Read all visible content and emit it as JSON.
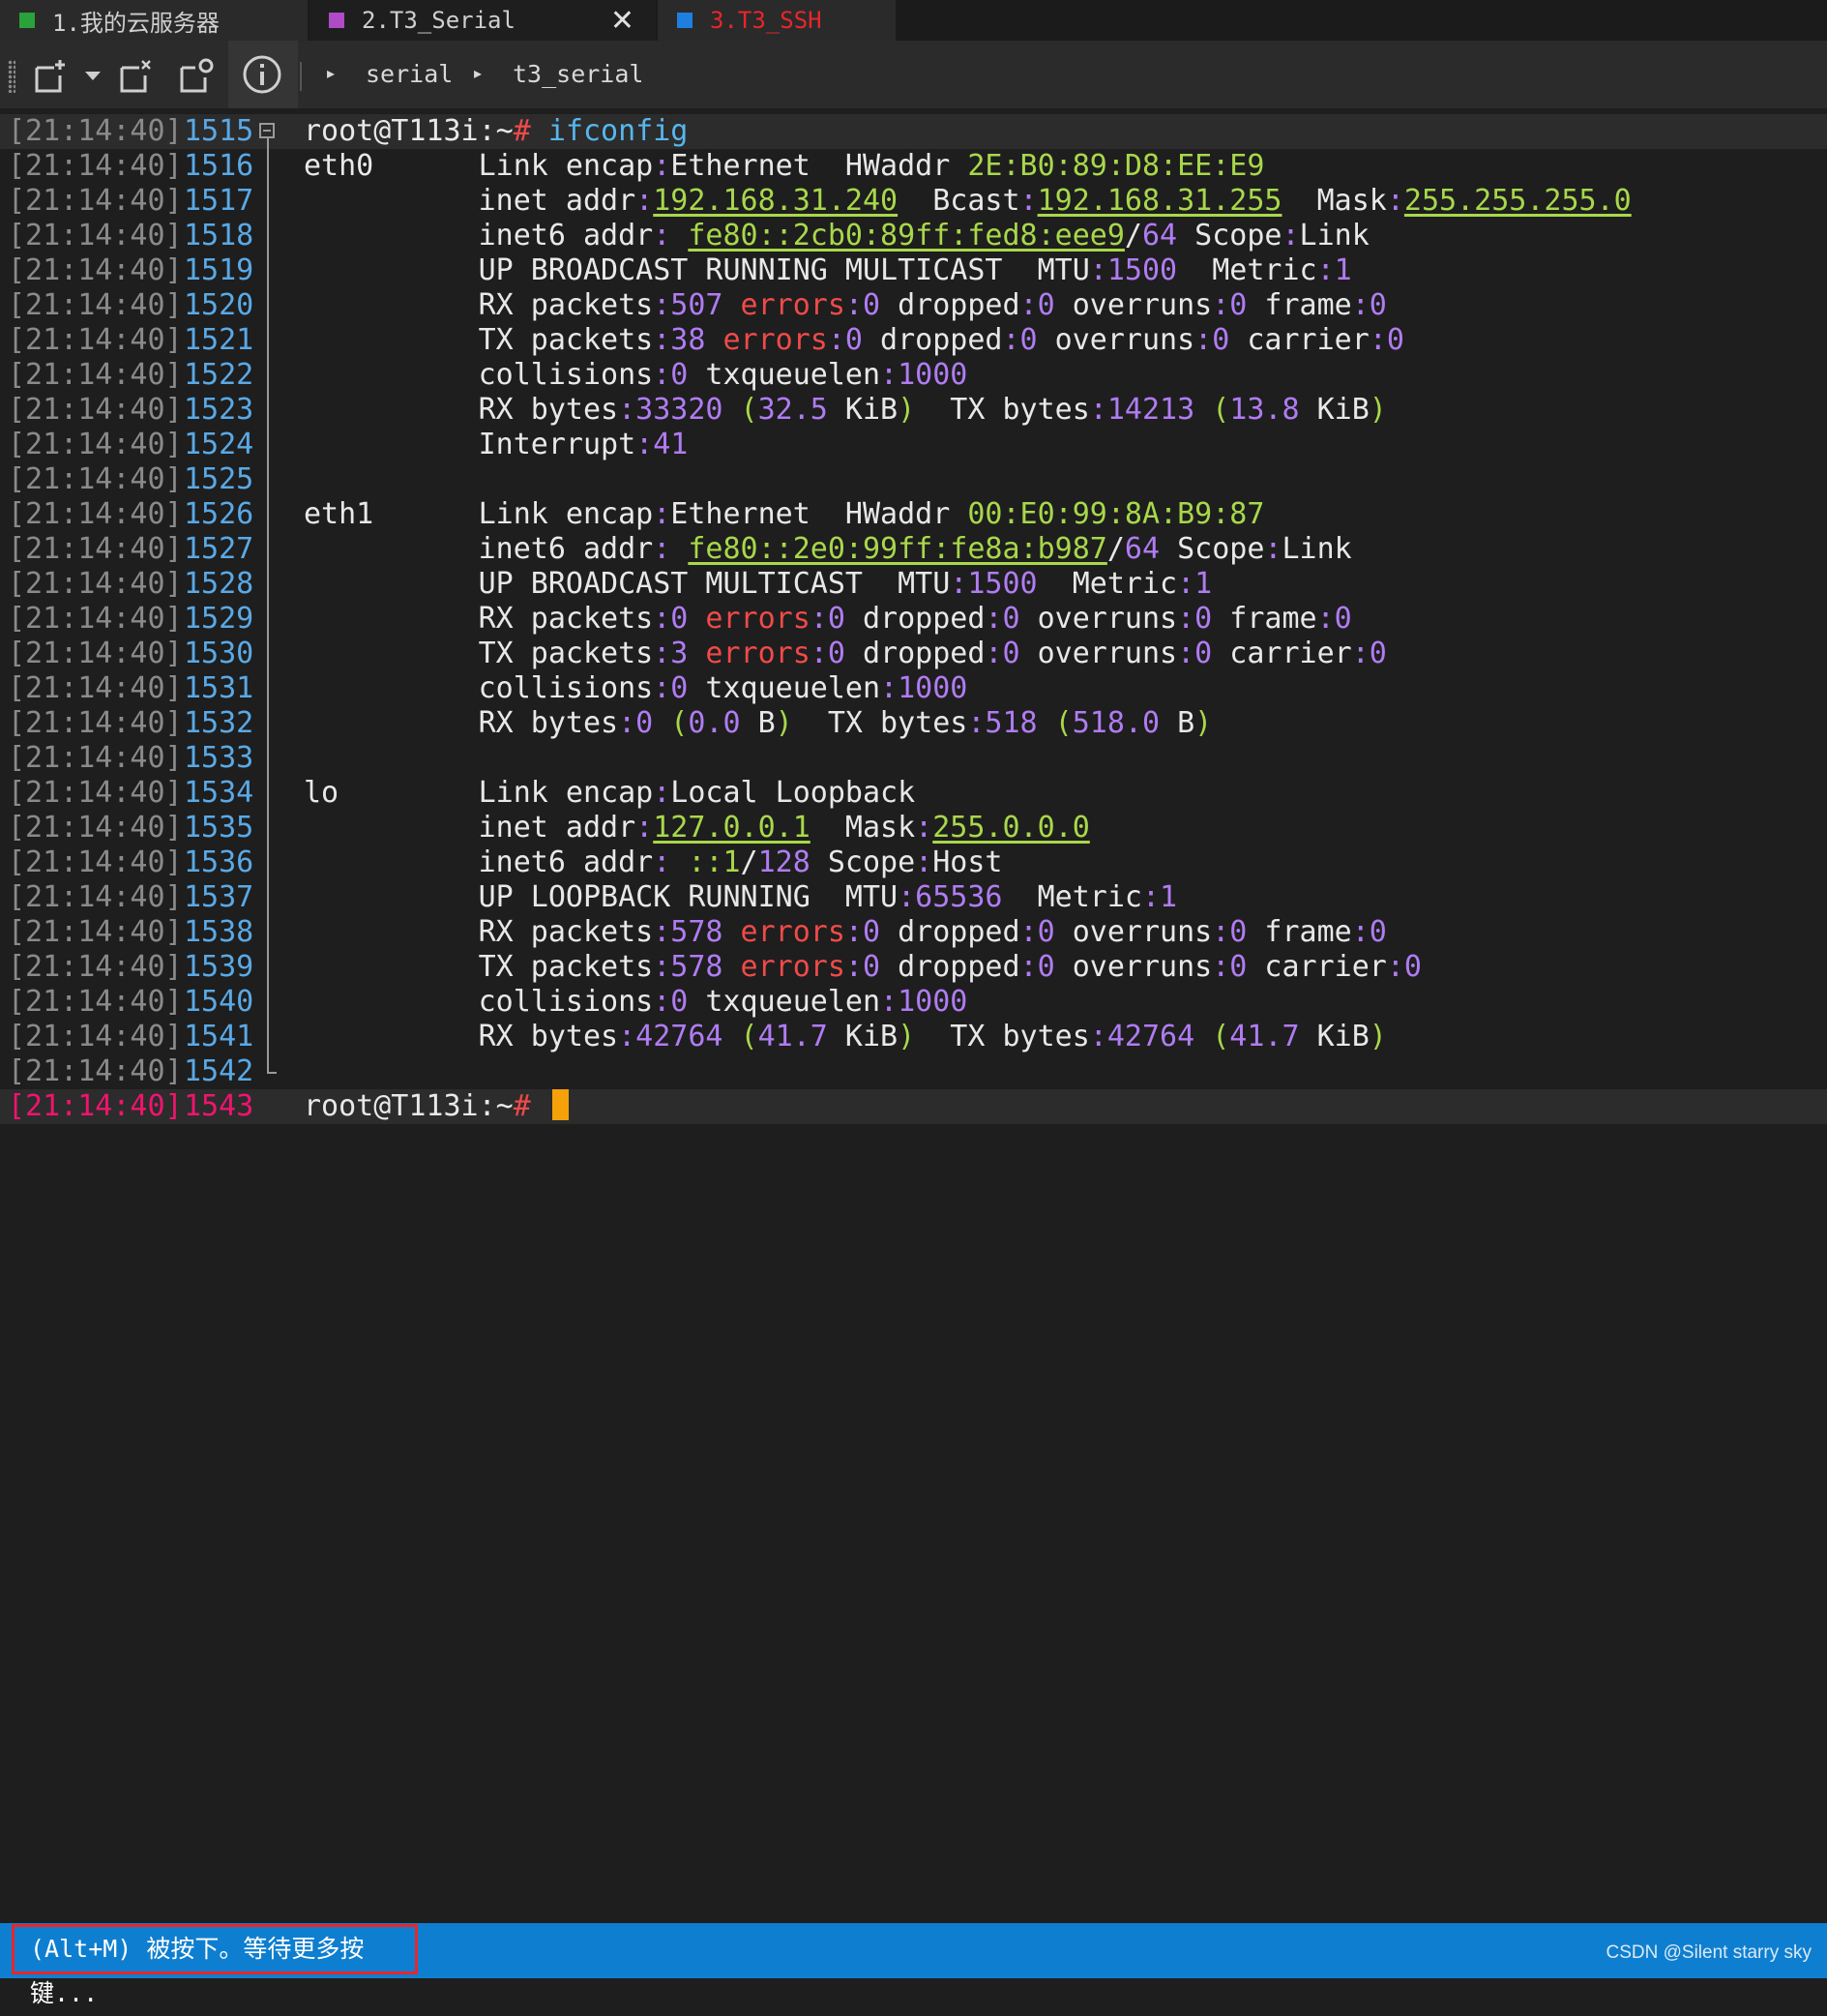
{
  "tabs": [
    {
      "label": "1.我的云服务器",
      "color": "#2aa13a"
    },
    {
      "label": "2.T3_Serial",
      "color": "#b04bc8"
    },
    {
      "label": "3.T3_SSH",
      "color": "#1e7fe0"
    }
  ],
  "toolbar": {
    "icons": [
      "grip-icon",
      "new-session-icon",
      "dropdown-chevron-icon",
      "close-session-icon",
      "duplicate-session-icon",
      "info-icon"
    ],
    "breadcrumb": [
      "serial",
      "t3_serial"
    ]
  },
  "terminal": {
    "timestamp": "[21:14:40]",
    "lines": [
      {
        "n": "1515",
        "segs": [
          [
            "root@T113i:~",
            "w"
          ],
          [
            "# ",
            "r"
          ],
          [
            "ifconfig",
            "b"
          ]
        ]
      },
      {
        "n": "1516",
        "segs": [
          [
            "eth0      Link encap",
            "w"
          ],
          [
            ":",
            "p"
          ],
          [
            "Ethernet  HWaddr ",
            "w"
          ],
          [
            "2E:B0:89:D8:EE:E9",
            "g"
          ]
        ]
      },
      {
        "n": "1517",
        "segs": [
          [
            "          inet addr",
            "w"
          ],
          [
            ":",
            "p"
          ],
          [
            "192.168.31.240",
            "gu"
          ],
          [
            "  Bcast",
            "w"
          ],
          [
            ":",
            "p"
          ],
          [
            "192.168.31.255",
            "gu"
          ],
          [
            "  Mask",
            "w"
          ],
          [
            ":",
            "p"
          ],
          [
            "255.255.255.0",
            "gu"
          ]
        ]
      },
      {
        "n": "1518",
        "segs": [
          [
            "          inet6 addr",
            "w"
          ],
          [
            ": ",
            "p"
          ],
          [
            "fe80::2cb0:89ff:fed8:eee9",
            "gu"
          ],
          [
            "/",
            "w"
          ],
          [
            "64",
            "p"
          ],
          [
            " Scope",
            "w"
          ],
          [
            ":",
            "p"
          ],
          [
            "Link",
            "w"
          ]
        ]
      },
      {
        "n": "1519",
        "segs": [
          [
            "          UP BROADCAST RUNNING MULTICAST  MTU",
            "w"
          ],
          [
            ":",
            "p"
          ],
          [
            "1500",
            "p"
          ],
          [
            "  Metric",
            "w"
          ],
          [
            ":",
            "p"
          ],
          [
            "1",
            "p"
          ]
        ]
      },
      {
        "n": "1520",
        "segs": [
          [
            "          RX packets",
            "w"
          ],
          [
            ":",
            "p"
          ],
          [
            "507",
            "p"
          ],
          [
            " errors",
            "r"
          ],
          [
            ":",
            "p"
          ],
          [
            "0",
            "p"
          ],
          [
            " dropped",
            "w"
          ],
          [
            ":",
            "p"
          ],
          [
            "0",
            "p"
          ],
          [
            " overruns",
            "w"
          ],
          [
            ":",
            "p"
          ],
          [
            "0",
            "p"
          ],
          [
            " frame",
            "w"
          ],
          [
            ":",
            "p"
          ],
          [
            "0",
            "p"
          ]
        ]
      },
      {
        "n": "1521",
        "segs": [
          [
            "          TX packets",
            "w"
          ],
          [
            ":",
            "p"
          ],
          [
            "38",
            "p"
          ],
          [
            " errors",
            "r"
          ],
          [
            ":",
            "p"
          ],
          [
            "0",
            "p"
          ],
          [
            " dropped",
            "w"
          ],
          [
            ":",
            "p"
          ],
          [
            "0",
            "p"
          ],
          [
            " overruns",
            "w"
          ],
          [
            ":",
            "p"
          ],
          [
            "0",
            "p"
          ],
          [
            " carrier",
            "w"
          ],
          [
            ":",
            "p"
          ],
          [
            "0",
            "p"
          ]
        ]
      },
      {
        "n": "1522",
        "segs": [
          [
            "          collisions",
            "w"
          ],
          [
            ":",
            "p"
          ],
          [
            "0",
            "p"
          ],
          [
            " txqueuelen",
            "w"
          ],
          [
            ":",
            "p"
          ],
          [
            "1000",
            "p"
          ]
        ]
      },
      {
        "n": "1523",
        "segs": [
          [
            "          RX bytes",
            "w"
          ],
          [
            ":",
            "p"
          ],
          [
            "33320",
            "p"
          ],
          [
            " (",
            "g"
          ],
          [
            "32.5",
            "p"
          ],
          [
            " KiB",
            "w"
          ],
          [
            ")",
            "g"
          ],
          [
            "  TX bytes",
            "w"
          ],
          [
            ":",
            "p"
          ],
          [
            "14213",
            "p"
          ],
          [
            " (",
            "g"
          ],
          [
            "13.8",
            "p"
          ],
          [
            " KiB",
            "w"
          ],
          [
            ")",
            "g"
          ]
        ]
      },
      {
        "n": "1524",
        "segs": [
          [
            "          Interrupt",
            "w"
          ],
          [
            ":",
            "p"
          ],
          [
            "41",
            "p"
          ]
        ]
      },
      {
        "n": "1525",
        "segs": []
      },
      {
        "n": "1526",
        "segs": [
          [
            "eth1      Link encap",
            "w"
          ],
          [
            ":",
            "p"
          ],
          [
            "Ethernet  HWaddr ",
            "w"
          ],
          [
            "00:E0:99:8A:B9:87",
            "g"
          ]
        ]
      },
      {
        "n": "1527",
        "segs": [
          [
            "          inet6 addr",
            "w"
          ],
          [
            ": ",
            "p"
          ],
          [
            "fe80::2e0:99ff:fe8a:b987",
            "gu"
          ],
          [
            "/",
            "w"
          ],
          [
            "64",
            "p"
          ],
          [
            " Scope",
            "w"
          ],
          [
            ":",
            "p"
          ],
          [
            "Link",
            "w"
          ]
        ]
      },
      {
        "n": "1528",
        "segs": [
          [
            "          UP BROADCAST MULTICAST  MTU",
            "w"
          ],
          [
            ":",
            "p"
          ],
          [
            "1500",
            "p"
          ],
          [
            "  Metric",
            "w"
          ],
          [
            ":",
            "p"
          ],
          [
            "1",
            "p"
          ]
        ]
      },
      {
        "n": "1529",
        "segs": [
          [
            "          RX packets",
            "w"
          ],
          [
            ":",
            "p"
          ],
          [
            "0",
            "p"
          ],
          [
            " errors",
            "r"
          ],
          [
            ":",
            "p"
          ],
          [
            "0",
            "p"
          ],
          [
            " dropped",
            "w"
          ],
          [
            ":",
            "p"
          ],
          [
            "0",
            "p"
          ],
          [
            " overruns",
            "w"
          ],
          [
            ":",
            "p"
          ],
          [
            "0",
            "p"
          ],
          [
            " frame",
            "w"
          ],
          [
            ":",
            "p"
          ],
          [
            "0",
            "p"
          ]
        ]
      },
      {
        "n": "1530",
        "segs": [
          [
            "          TX packets",
            "w"
          ],
          [
            ":",
            "p"
          ],
          [
            "3",
            "p"
          ],
          [
            " errors",
            "r"
          ],
          [
            ":",
            "p"
          ],
          [
            "0",
            "p"
          ],
          [
            " dropped",
            "w"
          ],
          [
            ":",
            "p"
          ],
          [
            "0",
            "p"
          ],
          [
            " overruns",
            "w"
          ],
          [
            ":",
            "p"
          ],
          [
            "0",
            "p"
          ],
          [
            " carrier",
            "w"
          ],
          [
            ":",
            "p"
          ],
          [
            "0",
            "p"
          ]
        ]
      },
      {
        "n": "1531",
        "segs": [
          [
            "          collisions",
            "w"
          ],
          [
            ":",
            "p"
          ],
          [
            "0",
            "p"
          ],
          [
            " txqueuelen",
            "w"
          ],
          [
            ":",
            "p"
          ],
          [
            "1000",
            "p"
          ]
        ]
      },
      {
        "n": "1532",
        "segs": [
          [
            "          RX bytes",
            "w"
          ],
          [
            ":",
            "p"
          ],
          [
            "0",
            "p"
          ],
          [
            " (",
            "g"
          ],
          [
            "0.0",
            "p"
          ],
          [
            " B",
            "w"
          ],
          [
            ")",
            "g"
          ],
          [
            "  TX bytes",
            "w"
          ],
          [
            ":",
            "p"
          ],
          [
            "518",
            "p"
          ],
          [
            " (",
            "g"
          ],
          [
            "518.0",
            "p"
          ],
          [
            " B",
            "w"
          ],
          [
            ")",
            "g"
          ]
        ]
      },
      {
        "n": "1533",
        "segs": []
      },
      {
        "n": "1534",
        "segs": [
          [
            "lo        Link encap",
            "w"
          ],
          [
            ":",
            "p"
          ],
          [
            "Local Loopback",
            "w"
          ]
        ]
      },
      {
        "n": "1535",
        "segs": [
          [
            "          inet addr",
            "w"
          ],
          [
            ":",
            "p"
          ],
          [
            "127.0.0.1",
            "gu"
          ],
          [
            "  Mask",
            "w"
          ],
          [
            ":",
            "p"
          ],
          [
            "255.0.0.0",
            "gu"
          ]
        ]
      },
      {
        "n": "1536",
        "segs": [
          [
            "          inet6 addr",
            "w"
          ],
          [
            ": ",
            "p"
          ],
          [
            "::1",
            "g"
          ],
          [
            "/",
            "w"
          ],
          [
            "128",
            "p"
          ],
          [
            " Scope",
            "w"
          ],
          [
            ":",
            "p"
          ],
          [
            "Host",
            "w"
          ]
        ]
      },
      {
        "n": "1537",
        "segs": [
          [
            "          UP LOOPBACK RUNNING  MTU",
            "w"
          ],
          [
            ":",
            "p"
          ],
          [
            "65536",
            "p"
          ],
          [
            "  Metric",
            "w"
          ],
          [
            ":",
            "p"
          ],
          [
            "1",
            "p"
          ]
        ]
      },
      {
        "n": "1538",
        "segs": [
          [
            "          RX packets",
            "w"
          ],
          [
            ":",
            "p"
          ],
          [
            "578",
            "p"
          ],
          [
            " errors",
            "r"
          ],
          [
            ":",
            "p"
          ],
          [
            "0",
            "p"
          ],
          [
            " dropped",
            "w"
          ],
          [
            ":",
            "p"
          ],
          [
            "0",
            "p"
          ],
          [
            " overruns",
            "w"
          ],
          [
            ":",
            "p"
          ],
          [
            "0",
            "p"
          ],
          [
            " frame",
            "w"
          ],
          [
            ":",
            "p"
          ],
          [
            "0",
            "p"
          ]
        ]
      },
      {
        "n": "1539",
        "segs": [
          [
            "          TX packets",
            "w"
          ],
          [
            ":",
            "p"
          ],
          [
            "578",
            "p"
          ],
          [
            " errors",
            "r"
          ],
          [
            ":",
            "p"
          ],
          [
            "0",
            "p"
          ],
          [
            " dropped",
            "w"
          ],
          [
            ":",
            "p"
          ],
          [
            "0",
            "p"
          ],
          [
            " overruns",
            "w"
          ],
          [
            ":",
            "p"
          ],
          [
            "0",
            "p"
          ],
          [
            " carrier",
            "w"
          ],
          [
            ":",
            "p"
          ],
          [
            "0",
            "p"
          ]
        ]
      },
      {
        "n": "1540",
        "segs": [
          [
            "          collisions",
            "w"
          ],
          [
            ":",
            "p"
          ],
          [
            "0",
            "p"
          ],
          [
            " txqueuelen",
            "w"
          ],
          [
            ":",
            "p"
          ],
          [
            "1000",
            "p"
          ]
        ]
      },
      {
        "n": "1541",
        "segs": [
          [
            "          RX bytes",
            "w"
          ],
          [
            ":",
            "p"
          ],
          [
            "42764",
            "p"
          ],
          [
            " (",
            "g"
          ],
          [
            "41.7",
            "p"
          ],
          [
            " KiB",
            "w"
          ],
          [
            ")",
            "g"
          ],
          [
            "  TX bytes",
            "w"
          ],
          [
            ":",
            "p"
          ],
          [
            "42764",
            "p"
          ],
          [
            " (",
            "g"
          ],
          [
            "41.7",
            "p"
          ],
          [
            " KiB",
            "w"
          ],
          [
            ")",
            "g"
          ]
        ]
      },
      {
        "n": "1542",
        "segs": []
      },
      {
        "n": "1543",
        "segs": [
          [
            "root@T113i:~",
            "w"
          ],
          [
            "# ",
            "r"
          ]
        ],
        "active": true
      }
    ]
  },
  "status": {
    "message": "(Alt+M) 被按下。等待更多按键...",
    "watermark": "CSDN @Silent starry sky"
  }
}
